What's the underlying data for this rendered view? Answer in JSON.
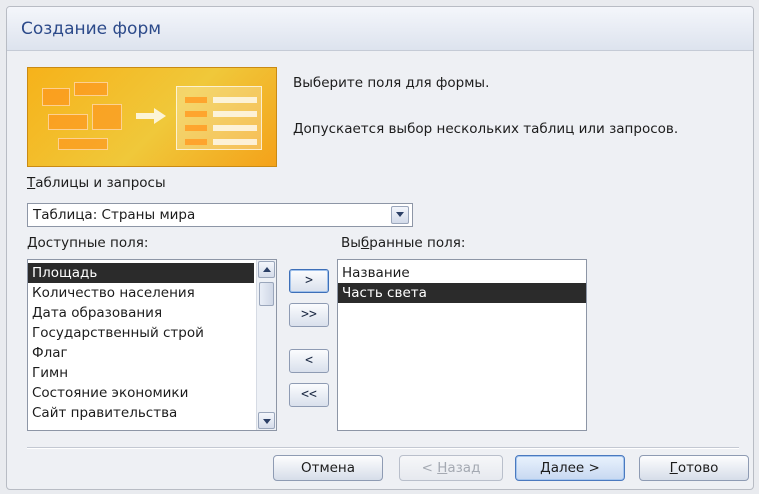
{
  "window": {
    "title": "Создание форм"
  },
  "intro": {
    "line1": "Выберите поля для формы.",
    "line2": "Допускается выбор нескольких таблиц или запросов."
  },
  "tables": {
    "label_u": "Т",
    "label_rest": "аблицы и запросы",
    "selected": "Таблица: Страны мира"
  },
  "available": {
    "label_u": "Д",
    "label_rest": "оступные поля:",
    "items": [
      "Площадь",
      "Количество населения",
      "Дата образования",
      "Государственный строй",
      "Флаг",
      "Гимн",
      "Состояние экономики",
      "Сайт правительства"
    ],
    "selected_index": 0
  },
  "selected_fields": {
    "label_a": "Вы",
    "label_u": "б",
    "label_rest": "ранные поля:",
    "items": [
      "Название",
      "Часть света"
    ],
    "selected_index": 1
  },
  "move_buttons": {
    "add_one": ">",
    "add_all": ">>",
    "remove_one": "<",
    "remove_all": "<<"
  },
  "buttons": {
    "cancel": "Отмена",
    "back_prefix": "< ",
    "back_u": "Н",
    "back_rest": "азад",
    "next_u": "Д",
    "next_rest": "алее >",
    "finish_u": "Г",
    "finish_rest": "отово"
  },
  "colors": {
    "title": "#2c4a8a",
    "selection": "#2b2b2b",
    "wizard_image": "#f6b21a"
  }
}
